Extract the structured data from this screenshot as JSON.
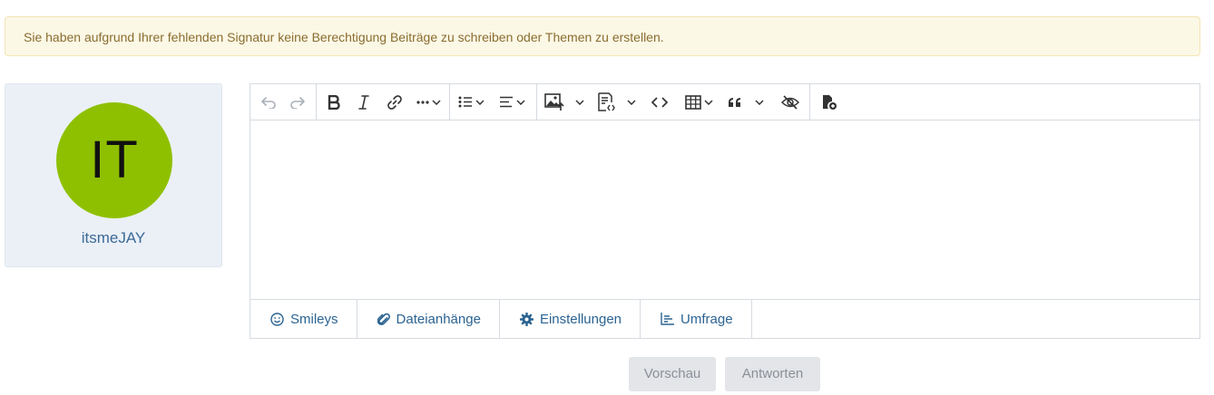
{
  "notice": {
    "text": "Sie haben aufgrund Ihrer fehlenden Signatur keine Berechtigung Beiträge zu schreiben oder Themen zu erstellen."
  },
  "user": {
    "initials": "IT",
    "name": "itsmeJAY",
    "avatar_color": "#8fc000"
  },
  "toolbar": {
    "buttons": [
      {
        "icon": "undo-icon",
        "enabled": false
      },
      {
        "icon": "redo-icon",
        "enabled": false
      },
      {
        "icon": "bold-icon"
      },
      {
        "icon": "italic-icon"
      },
      {
        "icon": "link-icon"
      },
      {
        "icon": "more-formatting-icon",
        "dropdown": true
      },
      {
        "icon": "bulleted-list-icon",
        "dropdown": true
      },
      {
        "icon": "align-left-icon",
        "dropdown": true
      },
      {
        "icon": "insert-image-icon",
        "dropdown": true
      },
      {
        "icon": "source-code-icon",
        "dropdown": true
      },
      {
        "icon": "code-icon"
      },
      {
        "icon": "table-icon",
        "dropdown": true
      },
      {
        "icon": "quote-icon",
        "dropdown": true
      },
      {
        "icon": "spoiler-hide-icon"
      },
      {
        "icon": "insert-file-icon"
      }
    ]
  },
  "tabs": [
    {
      "label": "Smileys",
      "icon": "smiley-icon"
    },
    {
      "label": "Dateianhänge",
      "icon": "paperclip-icon"
    },
    {
      "label": "Einstellungen",
      "icon": "gear-icon"
    },
    {
      "label": "Umfrage",
      "icon": "poll-chart-icon"
    }
  ],
  "actions": {
    "preview": "Vorschau",
    "submit": "Antworten"
  },
  "colors": {
    "notice_bg": "#fcf8e6",
    "notice_text": "#8a6d2f",
    "link": "#2b6391",
    "card_bg": "#ebf0f7"
  }
}
